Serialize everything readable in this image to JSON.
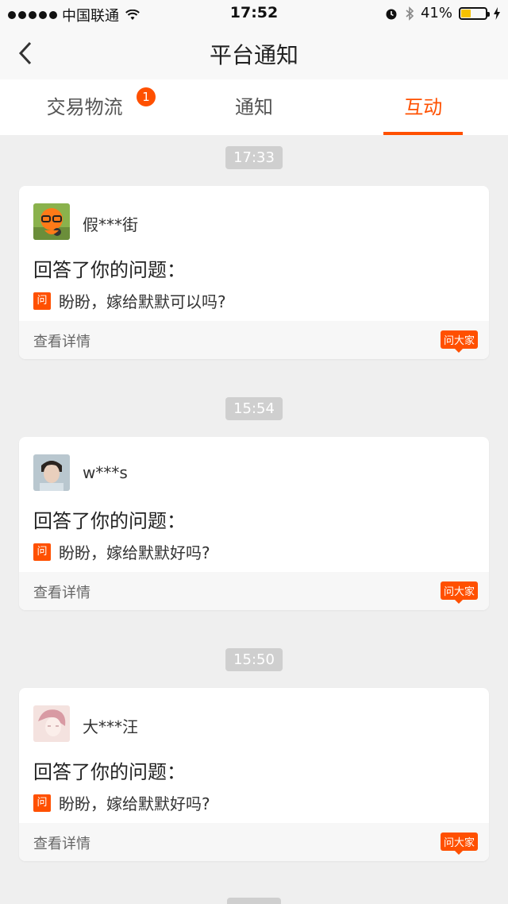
{
  "status_bar": {
    "carrier": "中国联通",
    "time": "17:52",
    "battery": "41%"
  },
  "nav": {
    "title": "平台通知"
  },
  "tabs": [
    {
      "label": "交易物流",
      "badge": "1",
      "active": false
    },
    {
      "label": "通知",
      "active": false
    },
    {
      "label": "互动",
      "active": true
    }
  ],
  "messages": [
    {
      "time": "17:33",
      "user": "假***街",
      "action": "回答了你的问题：",
      "question_tag": "问",
      "question": "盼盼，嫁给默默可以吗?",
      "detail": "查看详情",
      "source_tag": "问大家"
    },
    {
      "time": "15:54",
      "user": "w***s",
      "action": "回答了你的问题：",
      "question_tag": "问",
      "question": "盼盼，嫁给默默好吗?",
      "detail": "查看详情",
      "source_tag": "问大家"
    },
    {
      "time": "15:50",
      "user": "大***汪",
      "action": "回答了你的问题：",
      "question_tag": "问",
      "question": "盼盼，嫁给默默好吗?",
      "detail": "查看详情",
      "source_tag": "问大家"
    }
  ]
}
